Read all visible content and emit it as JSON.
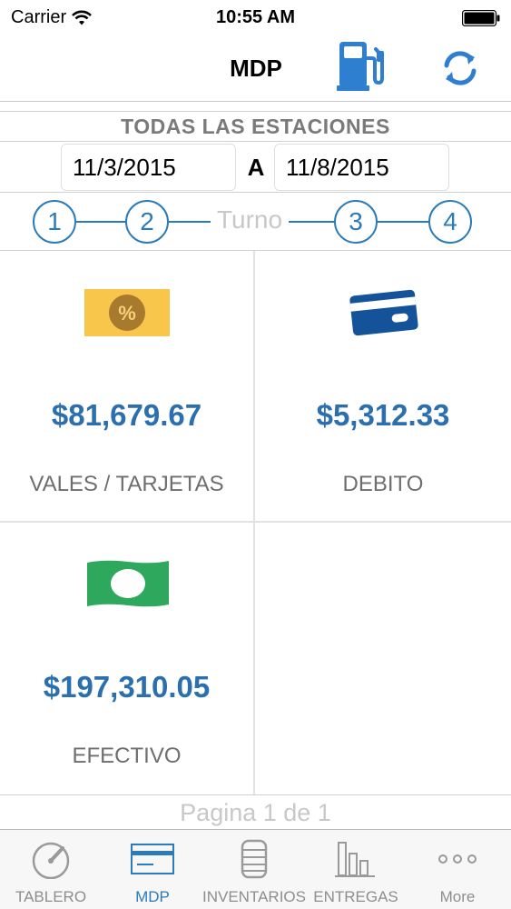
{
  "status_bar": {
    "carrier": "Carrier",
    "time": "10:55 AM"
  },
  "nav": {
    "title": "MDP",
    "fuel_icon": "fuel-pump-icon",
    "refresh_icon": "refresh-icon"
  },
  "station": {
    "label": "TODAS LAS ESTACIONES"
  },
  "date_range": {
    "from": "11/3/2015",
    "separator": "A",
    "to": "11/8/2015"
  },
  "shifts": {
    "label": "Turno",
    "steps": [
      "1",
      "2",
      "3",
      "4"
    ]
  },
  "cards": [
    {
      "amount": "$81,679.67",
      "label": "VALES / TARJETAS",
      "icon": "voucher-icon"
    },
    {
      "amount": "$5,312.33",
      "label": "DEBITO",
      "icon": "credit-card-icon"
    },
    {
      "amount": "$197,310.05",
      "label": "EFECTIVO",
      "icon": "cash-icon"
    }
  ],
  "pagination": {
    "text": "Pagina 1 de 1"
  },
  "tabs": [
    {
      "label": "TABLERO",
      "icon": "gauge-icon",
      "active": false
    },
    {
      "label": "MDP",
      "icon": "card-icon",
      "active": true
    },
    {
      "label": "INVENTARIOS",
      "icon": "tank-icon",
      "active": false
    },
    {
      "label": "ENTREGAS",
      "icon": "bar-chart-icon",
      "active": false
    },
    {
      "label": "More",
      "icon": "more-icon",
      "active": false
    }
  ],
  "colors": {
    "accent": "#2b7bb9",
    "amount": "#2b6fae",
    "voucher_yellow": "#f7c64a",
    "voucher_brown": "#a77a2e",
    "card_blue": "#14539a",
    "cash_green": "#2ea85c"
  }
}
